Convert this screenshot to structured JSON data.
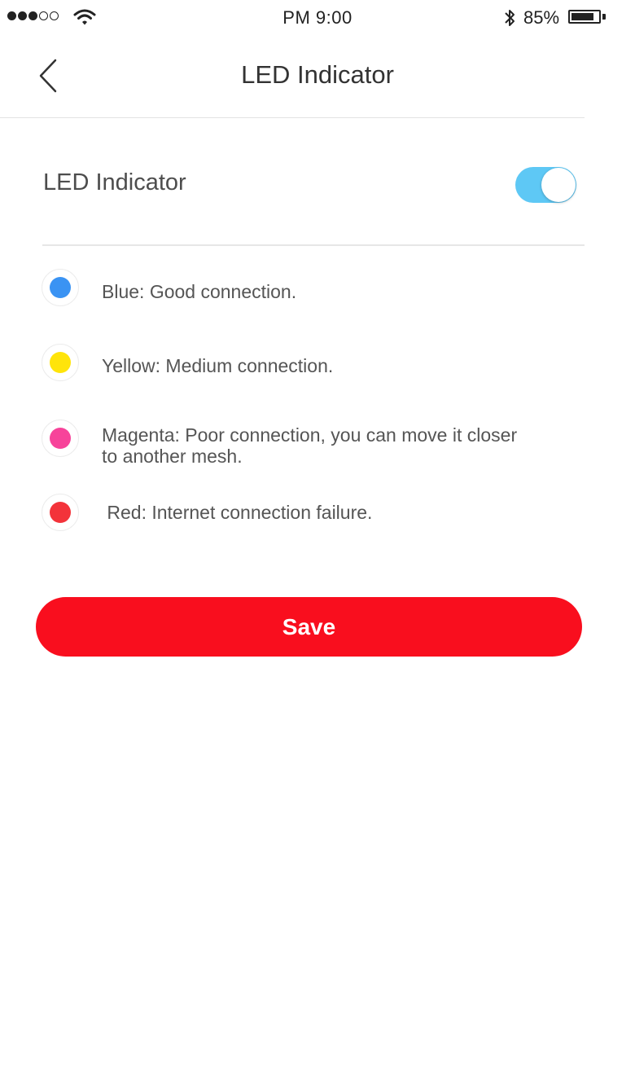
{
  "status_bar": {
    "time": "PM  9:00",
    "battery_percent": "85%",
    "signal_bars_filled": 3,
    "signal_bars_total": 5,
    "battery_level": 0.85
  },
  "nav": {
    "title": "LED Indicator",
    "back_icon": "chevron-left-icon"
  },
  "led_toggle": {
    "label": "LED Indicator",
    "enabled": true,
    "on_color": "#5ec8f5"
  },
  "legend": [
    {
      "color_name": "blue",
      "color": "#3a93f3",
      "text": "Blue: Good connection."
    },
    {
      "color_name": "yellow",
      "color": "#ffe40a",
      "text": "Yellow: Medium connection."
    },
    {
      "color_name": "magenta",
      "color": "#f7439a",
      "text": "Magenta: Poor connection, you can move it closer to another mesh."
    },
    {
      "color_name": "red",
      "color": "#f3333a",
      "text": " Red: Internet connection failure."
    }
  ],
  "save_button": {
    "label": "Save",
    "color": "#f90e1e"
  }
}
